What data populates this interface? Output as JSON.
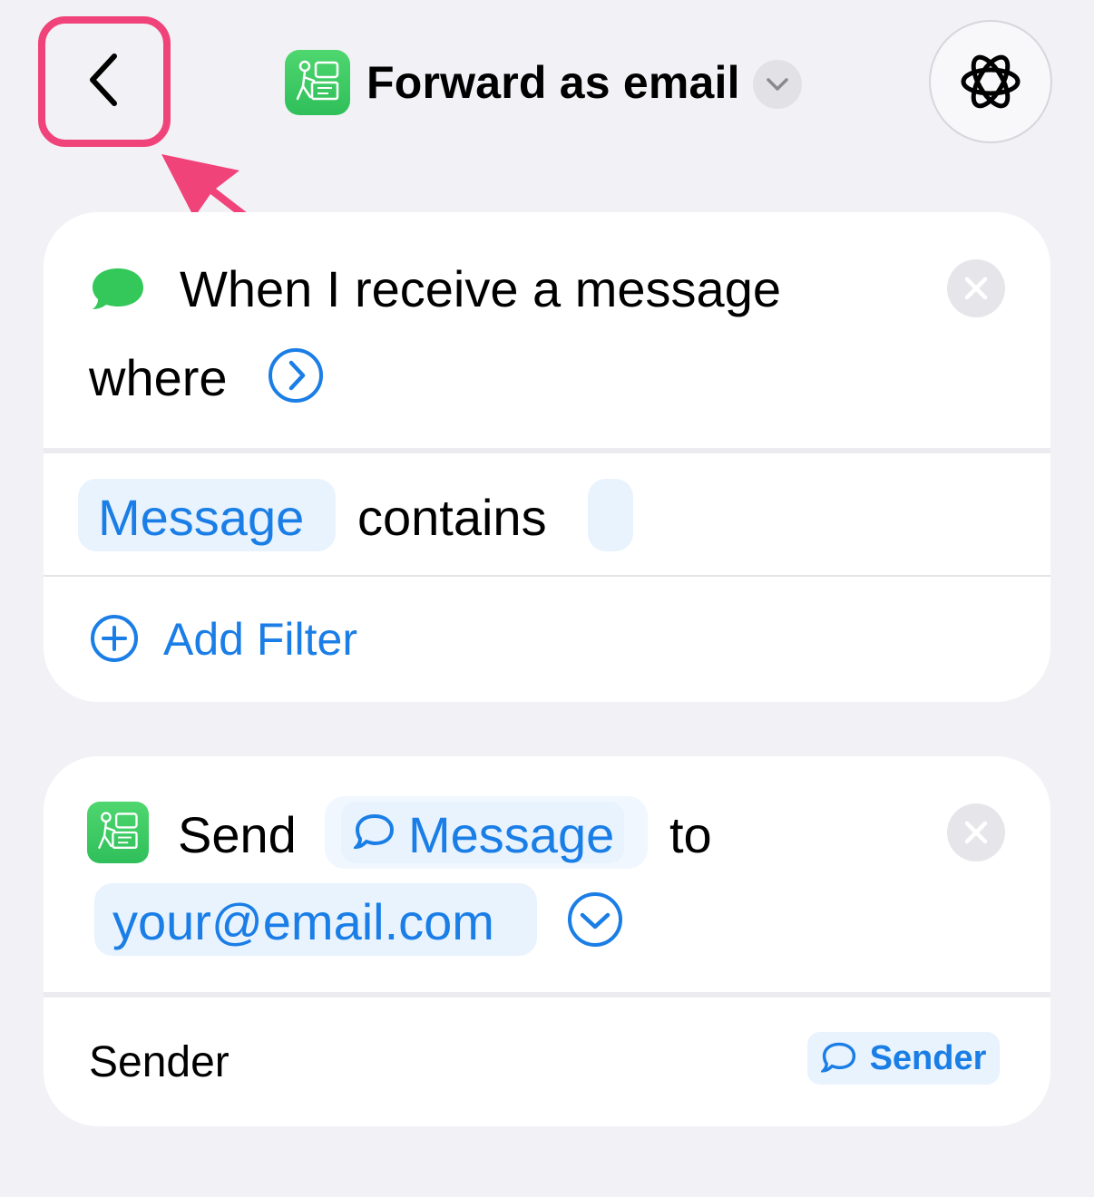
{
  "header": {
    "back_icon": "chevron-left-icon",
    "title": "Forward as email",
    "app_icon": "sms-forward-app-icon",
    "ai_icon": "apple-intelligence-icon",
    "highlight_color": "#f0437a"
  },
  "trigger_card": {
    "title": "When I receive a message",
    "where_label": "where",
    "filter": {
      "field": "Message",
      "operator": "contains",
      "value": ""
    },
    "add_filter_label": "Add Filter"
  },
  "action_card": {
    "verb": "Send",
    "message_token": "Message",
    "to_label": "to",
    "recipient": "your@email.com",
    "param_label": "Sender",
    "param_token": "Sender"
  },
  "colors": {
    "accent": "#1a7ee6",
    "background": "#f2f2f6",
    "message_green": "#34c759"
  }
}
